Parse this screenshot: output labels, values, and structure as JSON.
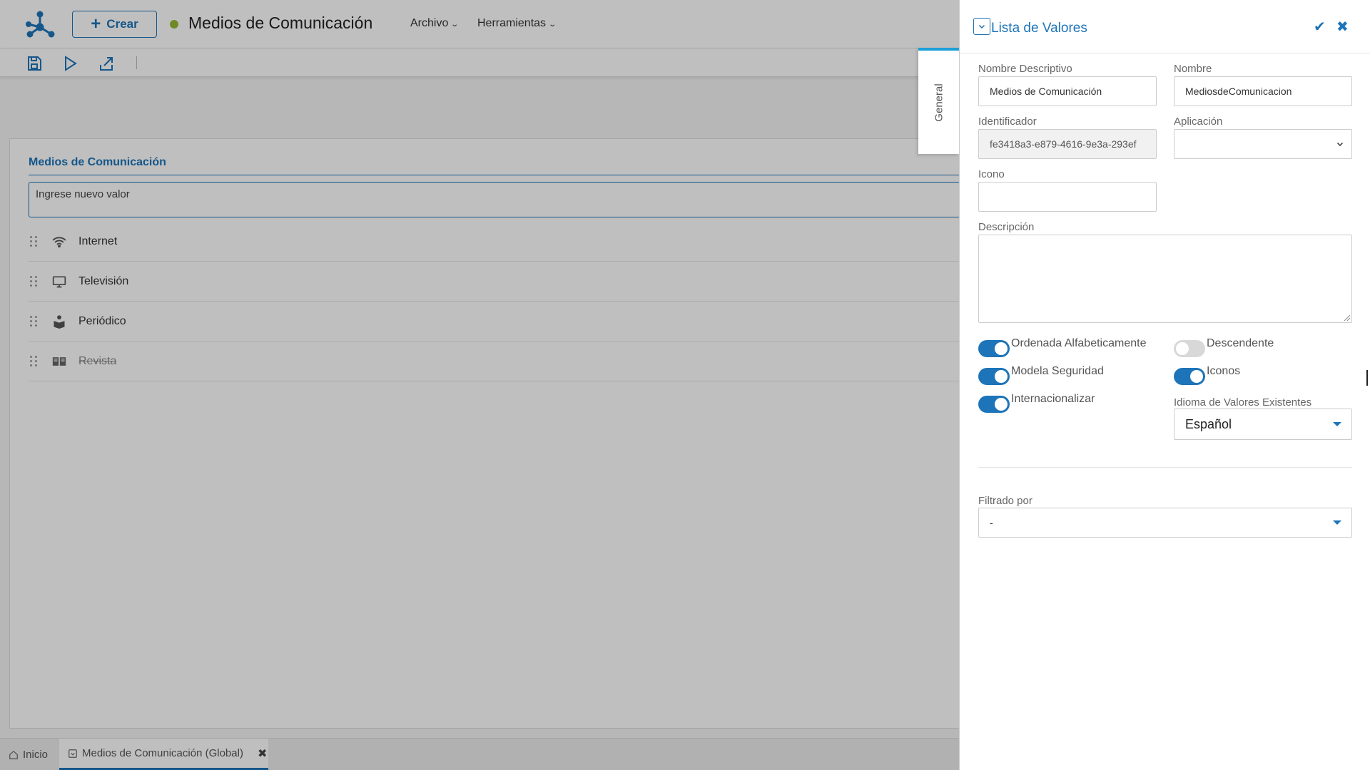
{
  "header": {
    "create_label": "Crear",
    "title": "Medios de Comunicación",
    "status_color": "#93b832",
    "menus": [
      {
        "label": "Archivo"
      },
      {
        "label": "Herramientas"
      }
    ]
  },
  "toolbar": {
    "icons": [
      "save-icon",
      "play-icon",
      "export-icon"
    ]
  },
  "list": {
    "title": "Medios de Comunicación",
    "new_value_placeholder": "Ingrese nuevo valor",
    "items": [
      {
        "label": "Internet",
        "icon": "wifi-icon",
        "deleted": false
      },
      {
        "label": "Televisión",
        "icon": "monitor-icon",
        "deleted": false
      },
      {
        "label": "Periódico",
        "icon": "newspaper-reader-icon",
        "deleted": false
      },
      {
        "label": "Revista",
        "icon": "magazine-icon",
        "deleted": true
      }
    ]
  },
  "bottom_tabs": [
    {
      "label": "Inicio",
      "icon": "home-icon",
      "active": false
    },
    {
      "label": "Medios de Comunicación (Global)",
      "icon": "list-icon",
      "active": true
    }
  ],
  "drawer": {
    "side_tab": "General",
    "title": "Lista de Valores",
    "fields": {
      "nombre_descriptivo": {
        "label": "Nombre Descriptivo",
        "value": "Medios de Comunicación"
      },
      "nombre": {
        "label": "Nombre",
        "value": "MediosdeComunicacion"
      },
      "identificador": {
        "label": "Identificador",
        "value": "fe3418a3-e879-4616-9e3a-293ef"
      },
      "aplicacion": {
        "label": "Aplicación",
        "value": ""
      },
      "icono": {
        "label": "Icono",
        "value": ""
      },
      "descripcion": {
        "label": "Descripción",
        "value": ""
      }
    },
    "toggles": {
      "ordenada": {
        "label": "Ordenada Alfabeticamente",
        "on": true
      },
      "descendente": {
        "label": "Descendente",
        "on": false
      },
      "modela": {
        "label": "Modela Seguridad",
        "on": true
      },
      "iconos": {
        "label": "Iconos",
        "on": true
      },
      "internacionalizar": {
        "label": "Internacionalizar",
        "on": true
      }
    },
    "idioma": {
      "label": "Idioma de Valores Existentes",
      "value": "Español"
    },
    "filtrado": {
      "label": "Filtrado por",
      "value": "-"
    }
  },
  "colors": {
    "accent": "#1d74b8",
    "tab_accent": "#1d9fd8"
  }
}
